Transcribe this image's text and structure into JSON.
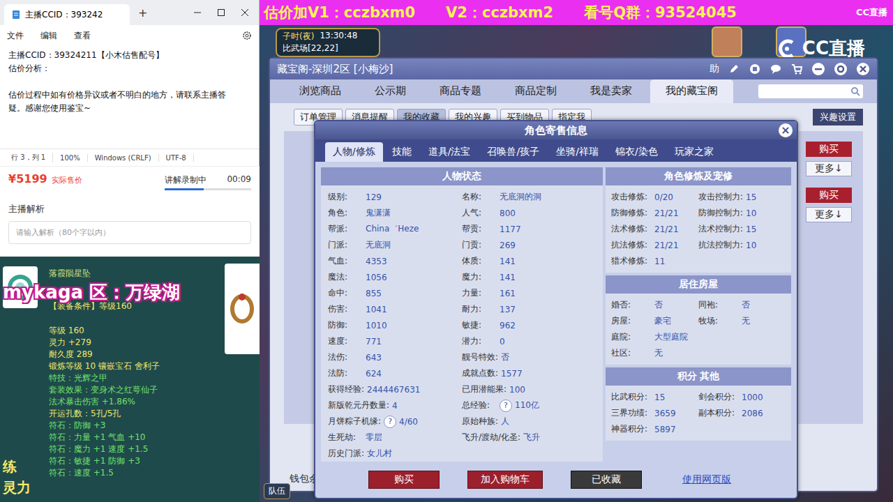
{
  "banner": {
    "segments": [
      "估价加V1：cczbxm0",
      "V2：cczbxm2",
      "看号Q群：93524045"
    ]
  },
  "cc_logo": {
    "small": "CC直播",
    "large": "CC直播"
  },
  "notepad": {
    "tab": "主播CCID：393242",
    "tab_add": "+",
    "menu": [
      "文件",
      "编辑",
      "查看"
    ],
    "lines": [
      "主播CCID：39324211【小木估售配号】",
      "估价分析：",
      "",
      "估价过程中如有价格异议或者不明白的地方，请联系主播答",
      "疑。感谢您使用鉴宝~"
    ],
    "status": [
      "行 3，列 1",
      "100%",
      "Windows (CRLF)",
      "UTF-8"
    ]
  },
  "sale_panel": {
    "price": "¥5199",
    "price_label": "实际售价",
    "recording": {
      "label": "讲解录制中",
      "time": "00:09",
      "level": 0.45
    },
    "analysis_title": "主播解析",
    "analysis_placeholder": "请输入解析（80个字以内）"
  },
  "item_tooltip": {
    "name": "落霞陨星坠",
    "requirement": "【装备条件】等级160",
    "lines": [
      {
        "text": "等级 160",
        "kind": "base"
      },
      {
        "text": "灵力 +279",
        "kind": "base"
      },
      {
        "text": "耐久度 289",
        "kind": "base"
      },
      {
        "text": "锻炼等级 10 镶嵌宝石 舍利子",
        "kind": "base"
      },
      {
        "text": "特技：光辉之甲",
        "kind": "green"
      },
      {
        "text": "套装效果：变身术之红萼仙子",
        "kind": "green"
      },
      {
        "text": "法术暴击伤害 +1.86%",
        "kind": "green"
      },
      {
        "text": "开运孔数：5孔/5孔",
        "kind": "base"
      },
      {
        "text": "符石：防御 +3",
        "kind": "green"
      },
      {
        "text": "符石：力量 +1 气血 +10",
        "kind": "green"
      },
      {
        "text": "符石：魔力 +1 速度 +1.5",
        "kind": "green"
      },
      {
        "text": "符石：敏捷 +1 防御 +3",
        "kind": "green"
      },
      {
        "text": "符石：速度 +1.5",
        "kind": "green"
      }
    ],
    "edge_text": [
      "练",
      "灵力"
    ],
    "watermark": "mykaga 区：万绿湖"
  },
  "game_hud": {
    "time_period": "子时(夜)",
    "clock": "13:30:48",
    "location": "比武场[22,22]",
    "team_button": "队伍"
  },
  "cbg_window": {
    "title": "藏宝阁-深圳2区 [小梅沙]",
    "help_button": "助",
    "tabs": [
      {
        "label": "浏览商品",
        "selected": false
      },
      {
        "label": "公示期",
        "selected": false
      },
      {
        "label": "商品专题",
        "selected": false
      },
      {
        "label": "商品定制",
        "selected": false
      },
      {
        "label": "我是卖家",
        "selected": false
      },
      {
        "label": "我的藏宝阁",
        "selected": true
      }
    ],
    "subtabs": [
      {
        "label": "订单管理",
        "selected": false
      },
      {
        "label": "消息提醒",
        "selected": false
      },
      {
        "label": "我的收藏",
        "selected": true
      },
      {
        "label": "我的兴趣",
        "selected": false
      },
      {
        "label": "买到物品",
        "selected": false
      },
      {
        "label": "指定我",
        "selected": false
      }
    ],
    "interest_button": "兴趣设置",
    "list_rows": [
      {
        "buy": "购买",
        "more": "更多↓"
      },
      {
        "buy": "购买",
        "more": "更多↓"
      }
    ],
    "wallet_text": "钱包余"
  },
  "role_modal": {
    "title": "角色寄售信息",
    "close": "×",
    "tabs": [
      {
        "label": "人物/修炼",
        "selected": true
      },
      {
        "label": "技能",
        "selected": false
      },
      {
        "label": "道具/法宝",
        "selected": false
      },
      {
        "label": "召唤兽/孩子",
        "selected": false
      },
      {
        "label": "坐骑/祥瑞",
        "selected": false
      },
      {
        "label": "锦衣/染色",
        "selected": false
      },
      {
        "label": "玩家之家",
        "selected": false
      }
    ],
    "status_title": "人物状态",
    "status_rows": [
      [
        {
          "label": "级别:",
          "help": "",
          "value": "129"
        },
        {
          "label": "名称:",
          "help": "",
          "value": "无底洞的洞"
        }
      ],
      [
        {
          "label": "角色:",
          "help": "",
          "value": "鬼潇潇"
        },
        {
          "label": "人气:",
          "help": "",
          "value": "800"
        }
      ],
      [
        {
          "label": "帮派:",
          "help": "",
          "value": "China゛Heze"
        },
        {
          "label": "帮贡:",
          "help": "",
          "value": "1177"
        }
      ],
      [
        {
          "label": "门派:",
          "help": "",
          "value": "无底洞"
        },
        {
          "label": "门贡:",
          "help": "",
          "value": "269"
        }
      ],
      [
        {
          "label": "气血:",
          "help": "",
          "value": "4353"
        },
        {
          "label": "体质:",
          "help": "",
          "value": "141"
        }
      ],
      [
        {
          "label": "魔法:",
          "help": "",
          "value": "1056"
        },
        {
          "label": "魔力:",
          "help": "",
          "value": "141"
        }
      ],
      [
        {
          "label": "命中:",
          "help": "",
          "value": "855"
        },
        {
          "label": "力量:",
          "help": "",
          "value": "161"
        }
      ],
      [
        {
          "label": "伤害:",
          "help": "",
          "value": "1041"
        },
        {
          "label": "耐力:",
          "help": "",
          "value": "137"
        }
      ],
      [
        {
          "label": "防御:",
          "help": "",
          "value": "1010"
        },
        {
          "label": "敏捷:",
          "help": "",
          "value": "962"
        }
      ],
      [
        {
          "label": "速度:",
          "help": "",
          "value": "771"
        },
        {
          "label": "潜力:",
          "help": "",
          "value": "0"
        }
      ],
      [
        {
          "label": "法伤:",
          "help": "",
          "value": "643"
        },
        {
          "label": "靓号特效:",
          "help": "",
          "value": "否"
        }
      ],
      [
        {
          "label": "法防:",
          "help": "",
          "value": "624"
        },
        {
          "label": "成就点数:",
          "help": "",
          "value": "1577"
        }
      ],
      [
        {
          "label": "获得经验:",
          "help": "",
          "value": "2444467631"
        },
        {
          "label": "已用潜能果:",
          "help": "",
          "value": "100"
        }
      ],
      [
        {
          "label": "新版乾元丹数量:",
          "help": "",
          "value": "4"
        },
        {
          "label": "总经验:",
          "help": "?",
          "value": "110亿"
        }
      ],
      [
        {
          "label": "月饼粽子机缘:",
          "help": "?",
          "value": "4/60"
        },
        {
          "label": "原始种族:",
          "help": "",
          "value": "人"
        }
      ],
      [
        {
          "label": "生死劫:",
          "help": "",
          "value": "零层"
        },
        {
          "label": "飞升/渡劫/化圣:",
          "help": "",
          "value": "飞升"
        }
      ],
      [
        {
          "label": "历史门派:",
          "help": "",
          "value": "女儿村"
        }
      ]
    ],
    "cultivation_title": "角色修炼及宠修",
    "cultivation_rows": [
      [
        {
          "label": "攻击修炼:",
          "value": "0/20"
        },
        {
          "label": "攻击控制力:",
          "value": "15"
        }
      ],
      [
        {
          "label": "防御修炼:",
          "value": "21/21"
        },
        {
          "label": "防御控制力:",
          "value": "10"
        }
      ],
      [
        {
          "label": "法术修炼:",
          "value": "21/21"
        },
        {
          "label": "法术控制力:",
          "value": "15"
        }
      ],
      [
        {
          "label": "抗法修炼:",
          "value": "21/21"
        },
        {
          "label": "抗法控制力:",
          "value": "10"
        }
      ],
      [
        {
          "label": "猎术修炼:",
          "value": "11"
        }
      ]
    ],
    "house_title": "居住房屋",
    "house_rows": [
      [
        {
          "label": "婚否:",
          "value": "否"
        },
        {
          "label": "同袍:",
          "value": "否"
        }
      ],
      [
        {
          "label": "房屋:",
          "value": "豪宅"
        },
        {
          "label": "牧场:",
          "value": "无"
        }
      ],
      [
        {
          "label": "庭院:",
          "value": "大型庭院"
        }
      ],
      [
        {
          "label": "社区:",
          "value": "无"
        }
      ]
    ],
    "score_title": "积分 其他",
    "score_rows": [
      [
        {
          "label": "比武积分:",
          "value": "15"
        },
        {
          "label": "剑会积分:",
          "value": "1000"
        }
      ],
      [
        {
          "label": "三界功绩:",
          "value": "3659"
        },
        {
          "label": "副本积分:",
          "value": "2086"
        }
      ],
      [
        {
          "label": "神器积分:",
          "value": "5897"
        }
      ]
    ],
    "buttons": [
      {
        "label": "购买",
        "kind": "red"
      },
      {
        "label": "加入购物车",
        "kind": "red"
      },
      {
        "label": "已收藏",
        "kind": "dark"
      },
      {
        "label": "使用网页版",
        "kind": "link"
      }
    ]
  }
}
